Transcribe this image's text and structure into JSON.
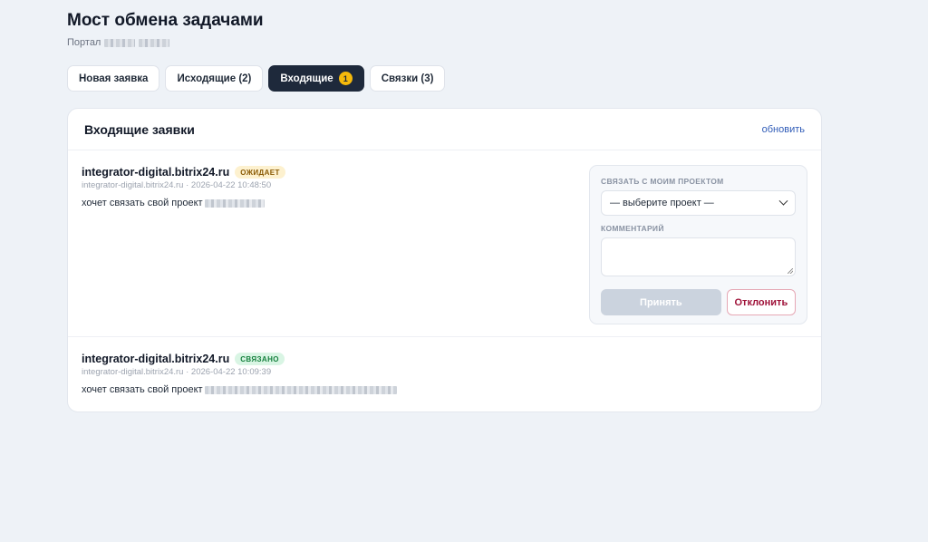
{
  "header": {
    "title": "Мост обмена задачами",
    "portal_label": "Портал"
  },
  "tabs": [
    {
      "label": "Новая заявка"
    },
    {
      "label": "Исходящие (2)"
    },
    {
      "label": "Входящие",
      "count": "1",
      "active": true
    },
    {
      "label": "Связки (3)"
    }
  ],
  "card": {
    "title": "Входящие заявки",
    "refresh_label": "обновить"
  },
  "requests": [
    {
      "host": "integrator-digital.bitrix24.ru",
      "status": "ОЖИДАЕТ",
      "meta": "integrator-digital.bitrix24.ru · 2026-04-22 10:48:50",
      "message": "хочет связать свой проект"
    },
    {
      "host": "integrator-digital.bitrix24.ru",
      "status": "СВЯЗАНО",
      "meta": "integrator-digital.bitrix24.ru · 2026-04-22 10:09:39",
      "message": "хочет связать свой проект"
    }
  ],
  "panel": {
    "link_label": "СВЯЗАТЬ С МОИМ ПРОЕКТОМ",
    "select_value": "— выберите проект —",
    "comment_label": "КОММЕНТАРИЙ",
    "accept_label": "Принять",
    "reject_label": "Отклонить"
  },
  "colors": {
    "background": "#eef2f7",
    "active_tab": "#1e293b",
    "count_badge": "#f5b90b",
    "waiting": "#fdf1cf",
    "linked": "#d9f5e4",
    "reject": "#9f1239",
    "link": "#2f5bb7"
  }
}
